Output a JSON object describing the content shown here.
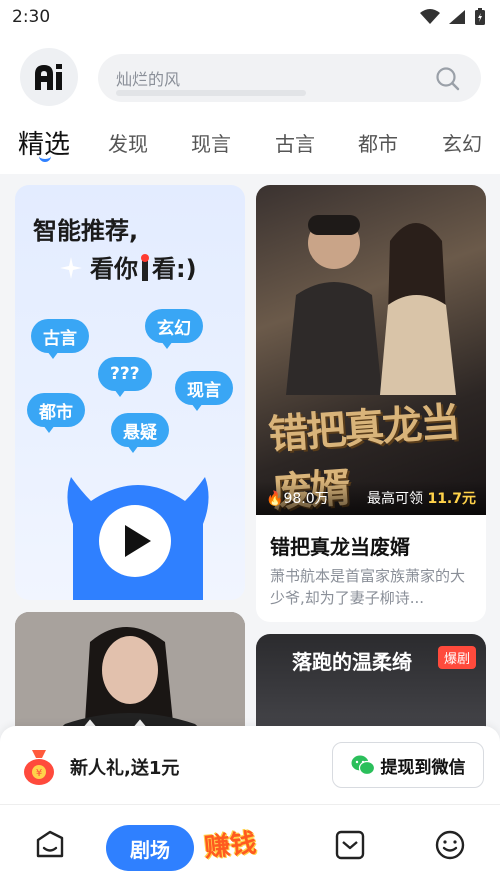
{
  "status_bar": {
    "time": "2:30"
  },
  "header": {
    "logo_text": "Ai",
    "search_placeholder": "灿烂的风"
  },
  "tabs": [
    "精选",
    "发现",
    "现言",
    "古言",
    "都市",
    "玄幻"
  ],
  "promo_card": {
    "line1": "智能推荐,",
    "line2": "看你",
    "line2_end": "看:)",
    "bubbles": [
      "古言",
      "玄幻",
      "???",
      "现言",
      "都市",
      "悬疑"
    ]
  },
  "drama_card_1": {
    "poster_art_text": "错把真龙当废婿",
    "views": "98.0万",
    "reward_label": "最高可领",
    "reward_amount": "11.7元",
    "title": "错把真龙当废婿",
    "description": "萧书航本是首富家族萧家的大少爷,却为了妻子柳诗..."
  },
  "drama_card_3": {
    "title_art": "落跑的温柔绮",
    "badge": "爆剧"
  },
  "reward_bar": {
    "text": "新人礼,送1元",
    "button": "提现到微信"
  },
  "bottom_nav": {
    "theater": "剧场",
    "earn": "赚钱"
  },
  "colors": {
    "accent": "#2f80ff",
    "bubble": "#39a6f5",
    "reward": "#ffd24a",
    "badge": "#ff4a3c"
  }
}
